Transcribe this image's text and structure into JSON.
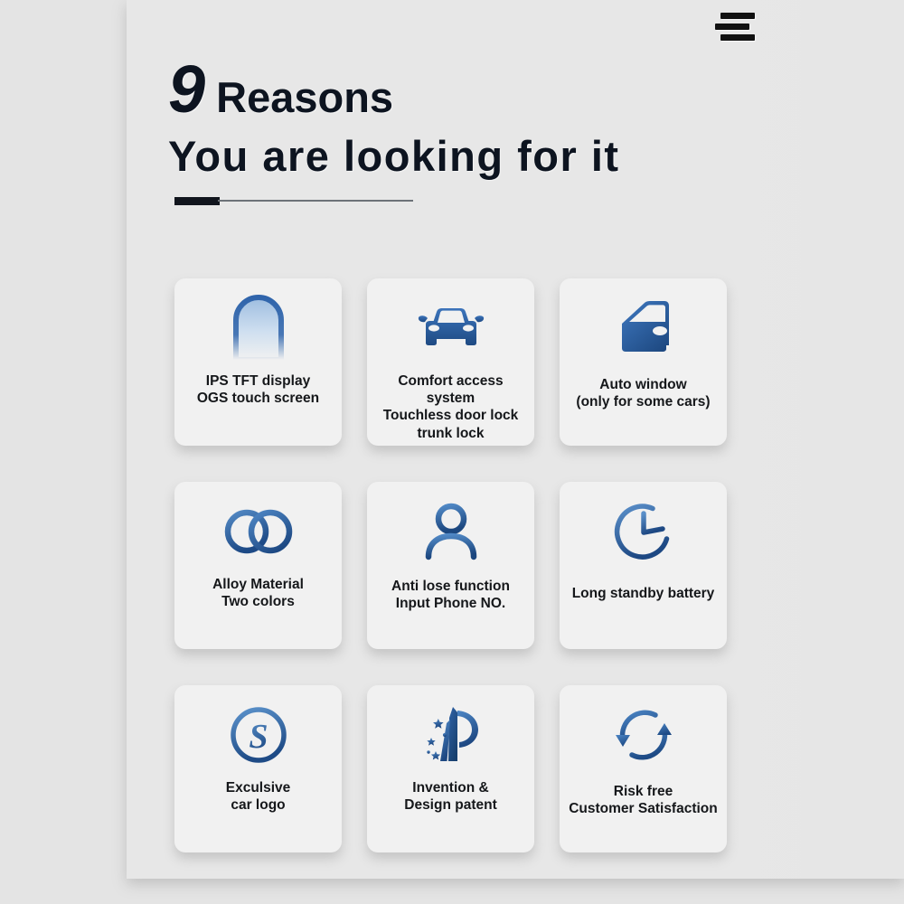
{
  "header": {
    "menu_icon": "hamburger-menu-icon"
  },
  "heading": {
    "numeral": "9",
    "word": "Reasons",
    "subtitle": "You are looking for it"
  },
  "colors": {
    "background": "#e4e4e4",
    "card": "#f1f1f1",
    "heading_text": "#0d1420",
    "accent_blue_dark": "#1f4e89",
    "accent_blue_mid": "#2f62a8",
    "accent_blue_light": "#a9c6e6"
  },
  "cards": [
    {
      "icon": "display-screen-icon",
      "label": "IPS TFT display\nOGS touch screen"
    },
    {
      "icon": "car-front-icon",
      "label": "Comfort access system\nTouchless door lock\ntrunk lock"
    },
    {
      "icon": "car-door-icon",
      "label": "Auto window\n(only for some cars)"
    },
    {
      "icon": "two-rings-icon",
      "label": "Alloy Material\nTwo colors"
    },
    {
      "icon": "person-icon",
      "label": "Anti lose function\nInput Phone NO."
    },
    {
      "icon": "clock-icon",
      "label": "Long standby battery"
    },
    {
      "icon": "s-logo-circle-icon",
      "label": "Exculsive\ncar logo"
    },
    {
      "icon": "patent-p-stars-icon",
      "label": "Invention &\nDesign patent"
    },
    {
      "icon": "refresh-cycle-icon",
      "label": "Risk free\nCustomer Satisfaction"
    }
  ]
}
